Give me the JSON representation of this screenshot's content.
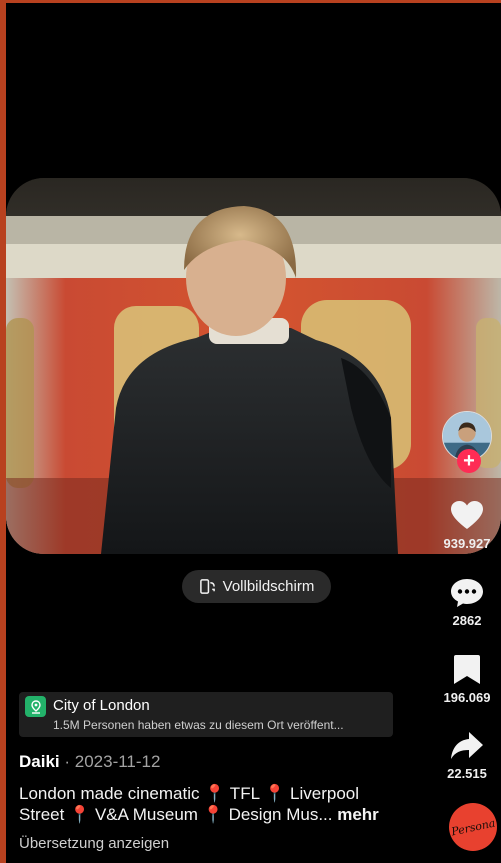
{
  "video": {
    "fullscreen_label": "Vollbildschirm"
  },
  "rail": {
    "likes": "939.927",
    "comments": "2862",
    "saves": "196.069",
    "shares": "22.515",
    "music_label": "Persona"
  },
  "location": {
    "title": "City of London",
    "subtitle": "1.5M Personen haben etwas zu diesem Ort veröffent..."
  },
  "post": {
    "author": "Daiki",
    "separator": " · ",
    "date": "2023-11-12",
    "caption_part1": "London made cinematic 📍 TFL 📍 Liverpool Street 📍 V&A Museum 📍 Design Mus...",
    "more_label": " mehr",
    "translate_label": "Übersetzung anzeigen"
  },
  "colors": {
    "like_accent": "#fe2c55",
    "location_icon": "#23b26a",
    "frame_accent": "#b8411f"
  }
}
